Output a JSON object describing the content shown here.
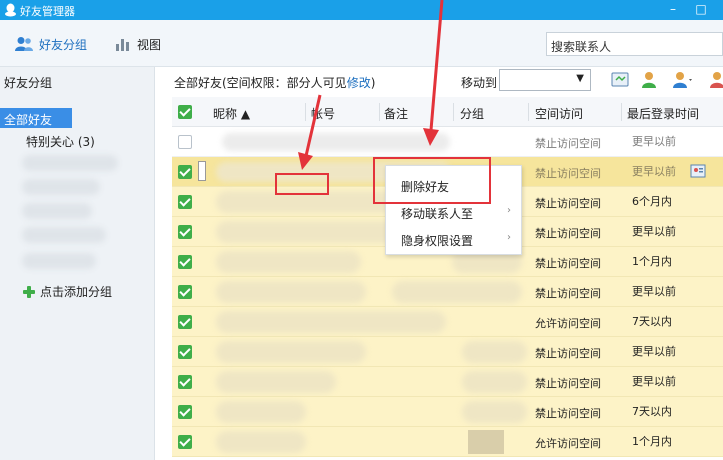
{
  "window": {
    "title": "好友管理器",
    "minimize": "–",
    "maximize": "□"
  },
  "toolbar": {
    "group_label": "好友分组",
    "view_label": "视图",
    "search_placeholder": "搜索联系人"
  },
  "sidebar": {
    "header": "好友分组",
    "all_item": "全部好友",
    "items": [
      {
        "label": "特别关心 (3)"
      }
    ],
    "add_group": "点击添加分组"
  },
  "listbar": {
    "perm_prefix": "全部好友(空间权限：部分人可见",
    "perm_link": "修改",
    "perm_suffix": ")",
    "move_to": "移动到"
  },
  "table": {
    "headers": {
      "nickname": "昵称 ▲",
      "account": "帐号",
      "remark": "备注",
      "group": "分组",
      "space": "空间访问",
      "last_login": "最后登录时间"
    },
    "rows": [
      {
        "checked": false,
        "space": "禁止访问空间",
        "last": "更早以前"
      },
      {
        "checked": true,
        "space": "禁止访问空间",
        "last": "更早以前"
      },
      {
        "checked": true,
        "space": "禁止访问空间",
        "last": "6个月内"
      },
      {
        "checked": true,
        "space": "禁止访问空间",
        "last": "更早以前"
      },
      {
        "checked": true,
        "space": "禁止访问空间",
        "last": "1个月内"
      },
      {
        "checked": true,
        "space": "禁止访问空间",
        "last": "更早以前"
      },
      {
        "checked": true,
        "space": "允许访问空间",
        "last": "7天以内"
      },
      {
        "checked": true,
        "space": "禁止访问空间",
        "last": "更早以前"
      },
      {
        "checked": true,
        "space": "禁止访问空间",
        "last": "更早以前"
      },
      {
        "checked": true,
        "space": "禁止访问空间",
        "last": "7天以内"
      },
      {
        "checked": true,
        "space": "允许访问空间",
        "last": "1个月内"
      }
    ]
  },
  "context_menu": {
    "delete": "删除好友",
    "move": "移动联系人至",
    "privacy": "隐身权限设置"
  },
  "colors": {
    "titlebar": "#1aa0e8",
    "accent": "#1d6fbf",
    "selected_row": "#f6e59c",
    "highlight": "#e3333a",
    "check": "#3fae49"
  }
}
